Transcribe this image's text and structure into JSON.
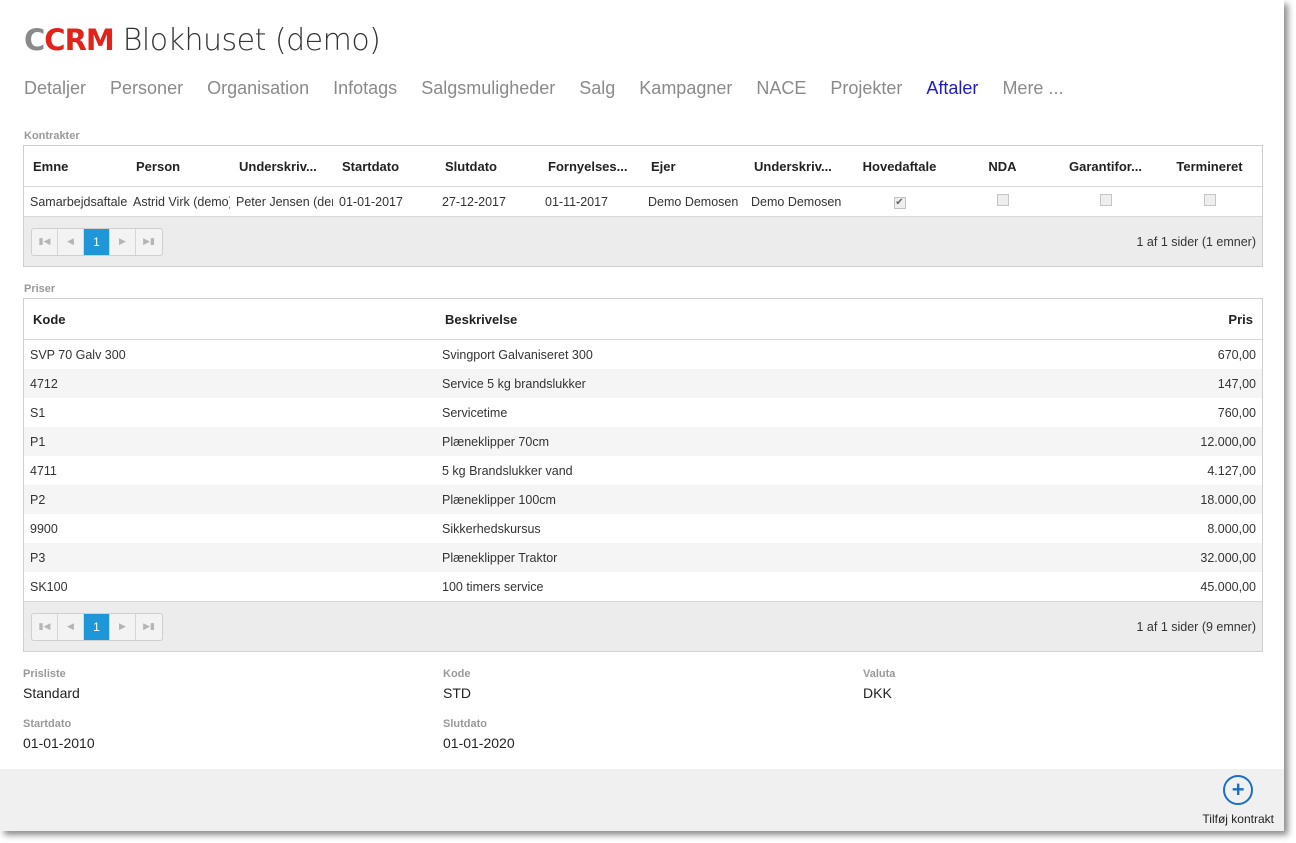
{
  "header": {
    "logo_c": "C",
    "logo_crm": "CRM",
    "title": "Blokhuset (demo)"
  },
  "tabs": [
    {
      "label": "Detaljer"
    },
    {
      "label": "Personer"
    },
    {
      "label": "Organisation"
    },
    {
      "label": "Infotags"
    },
    {
      "label": "Salgsmuligheder"
    },
    {
      "label": "Salg"
    },
    {
      "label": "Kampagner"
    },
    {
      "label": "NACE"
    },
    {
      "label": "Projekter"
    },
    {
      "label": "Aftaler",
      "active": true
    },
    {
      "label": "Mere ..."
    }
  ],
  "contracts": {
    "section_label": "Kontrakter",
    "columns": [
      "Emne",
      "Person",
      "Underskriv...",
      "Startdato",
      "Slutdato",
      "Fornyelses...",
      "Ejer",
      "Underskriv...",
      "Hovedaftale",
      "NDA",
      "Garantifor...",
      "Termineret"
    ],
    "rows": [
      {
        "emne": "Samarbejdsaftale",
        "person": "Astrid Virk (demo)",
        "underskriver_kunde": "Peter Jensen (demo)",
        "startdato": "01-01-2017",
        "slutdato": "27-12-2017",
        "fornyelse": "01-11-2017",
        "ejer": "Demo Demosen",
        "underskriver_egen": "Demo Demosen",
        "hovedaftale": true,
        "nda": false,
        "garanti": false,
        "termineret": false
      }
    ],
    "pager": {
      "current_page": "1",
      "info": "1 af 1 sider (1 emner)"
    }
  },
  "prices": {
    "section_label": "Priser",
    "columns": {
      "code": "Kode",
      "description": "Beskrivelse",
      "price": "Pris"
    },
    "rows": [
      {
        "code": "SVP 70 Galv 300",
        "description": "Svingport Galvaniseret 300",
        "price": "670,00"
      },
      {
        "code": "4712",
        "description": "Service 5 kg brandslukker",
        "price": "147,00"
      },
      {
        "code": "S1",
        "description": "Servicetime",
        "price": "760,00"
      },
      {
        "code": "P1",
        "description": "Plæneklipper 70cm",
        "price": "12.000,00"
      },
      {
        "code": "4711",
        "description": "5 kg Brandslukker vand",
        "price": "4.127,00"
      },
      {
        "code": "P2",
        "description": "Plæneklipper 100cm",
        "price": "18.000,00"
      },
      {
        "code": "9900",
        "description": "Sikkerhedskursus",
        "price": "8.000,00"
      },
      {
        "code": "P3",
        "description": "Plæneklipper Traktor",
        "price": "32.000,00"
      },
      {
        "code": "SK100",
        "description": "100 timers service",
        "price": "45.000,00"
      }
    ],
    "pager": {
      "current_page": "1",
      "info": "1 af 1 sider (9 emner)"
    }
  },
  "pricelist_details": {
    "prisliste": {
      "label": "Prisliste",
      "value": "Standard"
    },
    "kode": {
      "label": "Kode",
      "value": "STD"
    },
    "valuta": {
      "label": "Valuta",
      "value": "DKK"
    },
    "startdato": {
      "label": "Startdato",
      "value": "01-01-2010"
    },
    "slutdato": {
      "label": "Slutdato",
      "value": "01-01-2020"
    }
  },
  "footer": {
    "add_contract_icon": "plus-circle-icon",
    "add_contract_label": "Tilføj kontrakt"
  },
  "colors": {
    "active_tab": "#1d1ac9",
    "pager_current": "#1e96d8",
    "logo_red": "#e2231a",
    "add_button": "#1a6fc4"
  }
}
